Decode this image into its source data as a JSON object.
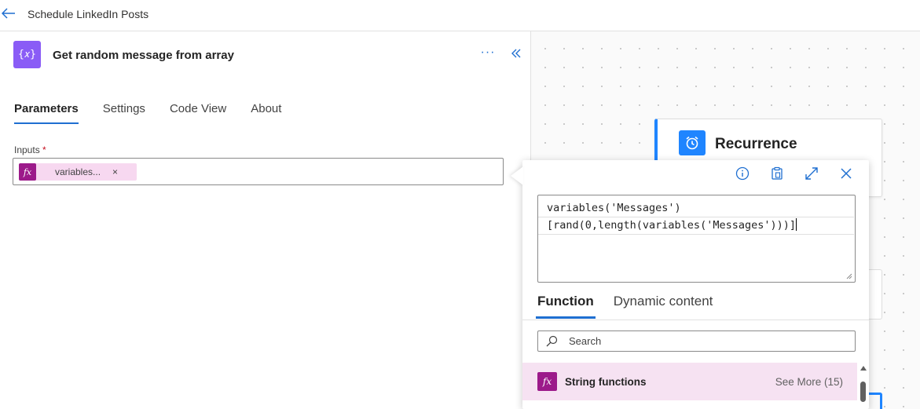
{
  "header": {
    "title": "Schedule LinkedIn Posts"
  },
  "canvas": {
    "recurrence_title": "Recurrence"
  },
  "panel": {
    "action_title": "Get random message from array",
    "more_label": "···",
    "tabs": [
      {
        "label": "Parameters",
        "active": true
      },
      {
        "label": "Settings",
        "active": false
      },
      {
        "label": "Code View",
        "active": false
      },
      {
        "label": "About",
        "active": false
      }
    ],
    "inputs_label": "Inputs",
    "required_mark": "*",
    "token": {
      "icon_text": "fx",
      "label": "variables...",
      "remove": "×"
    }
  },
  "popup": {
    "expression_line1": "variables('Messages')",
    "expression_line2": "[rand(0,length(variables('Messages')))]",
    "tabs": [
      {
        "label": "Function",
        "active": true
      },
      {
        "label": "Dynamic content",
        "active": false
      }
    ],
    "search": {
      "placeholder": "Search",
      "value": ""
    },
    "category": {
      "icon_text": "fx",
      "label": "String functions",
      "more": "See More (15)"
    }
  },
  "colors": {
    "accent": "#1f6fd1",
    "function_pink": "#9c1a8a",
    "token_bg": "#f7d8f0",
    "action_purple": "#8a5cf6",
    "recurrence_blue": "#1f85ff"
  }
}
